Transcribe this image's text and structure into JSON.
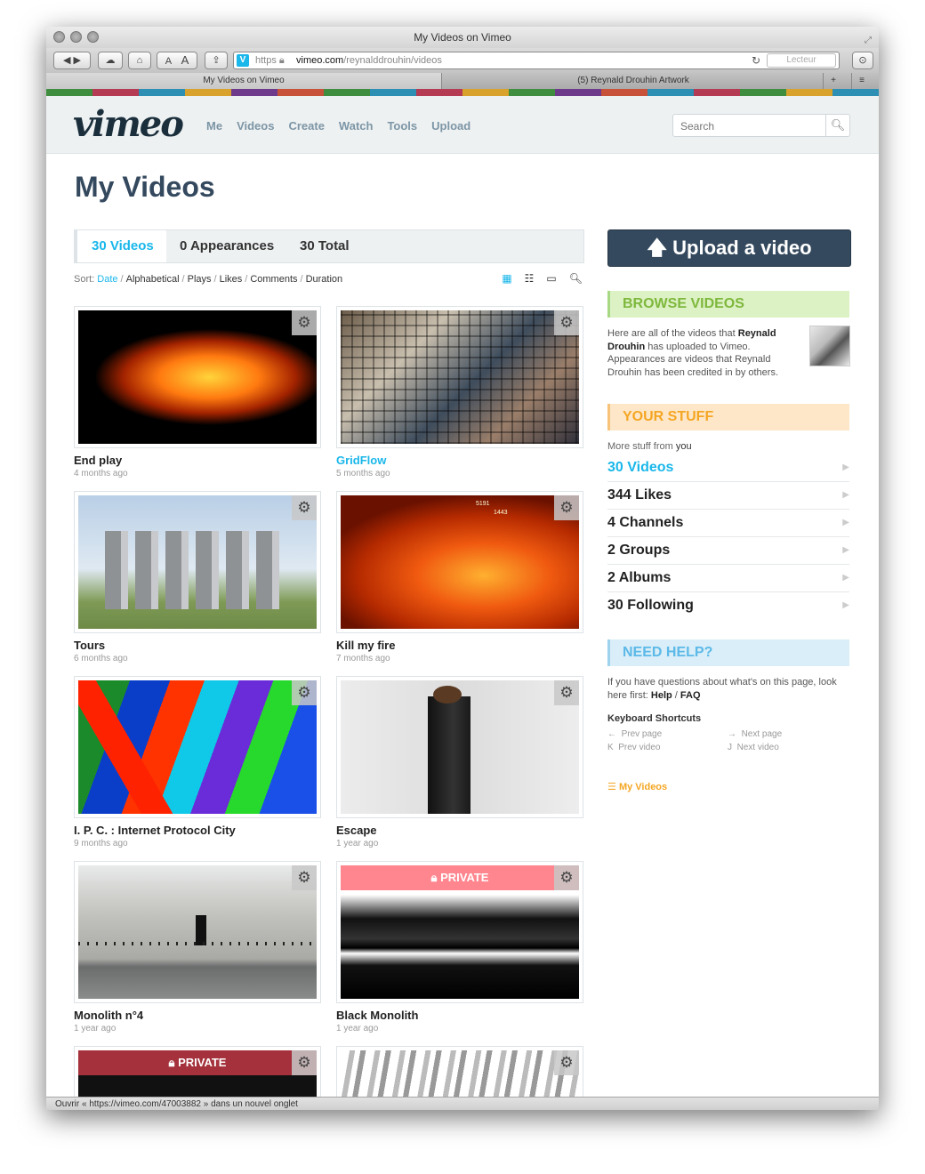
{
  "window": {
    "title": "My Videos on Vimeo",
    "url_scheme": "https",
    "url_host": "vimeo.com",
    "url_path": "/reynalddrouhin/videos",
    "reader_label": "Lecteur",
    "tabs": [
      "My Videos on Vimeo",
      "(5) Reynald Drouhin Artwork"
    ],
    "toolbar_text_small": "A",
    "toolbar_text_large": "A"
  },
  "header": {
    "logo": "vimeo",
    "nav": [
      "Me",
      "Videos",
      "Create",
      "Watch",
      "Tools",
      "Upload"
    ],
    "search_placeholder": "Search"
  },
  "page_title": "My Videos",
  "tabs": {
    "videos": "30 Videos",
    "appearances": "0 Appearances",
    "total": "30 Total"
  },
  "sort": {
    "label": "Sort:",
    "options": [
      "Date",
      "Alphabetical",
      "Plays",
      "Likes",
      "Comments",
      "Duration"
    ]
  },
  "videos": [
    {
      "title": "End play",
      "date": "4 months ago"
    },
    {
      "title": "GridFlow",
      "date": "5 months ago"
    },
    {
      "title": "Tours",
      "date": "6 months ago"
    },
    {
      "title": "Kill my fire",
      "date": "7 months ago"
    },
    {
      "title": "I. P. C. : Internet Protocol City",
      "date": "9 months ago"
    },
    {
      "title": "Escape",
      "date": "1 year ago"
    },
    {
      "title": "Monolith n°4",
      "date": "1 year ago"
    },
    {
      "title": "Black Monolith",
      "date": "1 year ago"
    }
  ],
  "private_label": "PRIVATE",
  "thumb_overlay": {
    "a": "5191",
    "b": "1443"
  },
  "sidebar": {
    "upload": "Upload a video",
    "browse_head": "BROWSE VIDEOS",
    "browse_text": {
      "p1": "Here are all of the videos that ",
      "name1": "Reynald Drouhin",
      "p2": " has uploaded to Vimeo. Appearances are videos that Reynald Drouhin has been credited in by others."
    },
    "stuff_head": "YOUR STUFF",
    "stuff_note_pre": "More stuff from ",
    "stuff_note_you": "you",
    "stuff": [
      "30 Videos",
      "344 Likes",
      "4 Channels",
      "2 Groups",
      "2 Albums",
      "30 Following"
    ],
    "help_head": "NEED HELP?",
    "help_text": {
      "p1": "If you have questions about what's on this page, look here first: ",
      "help": "Help",
      "sep": " / ",
      "faq": "FAQ"
    },
    "shortcuts_title": "Keyboard Shortcuts",
    "shortcuts": {
      "prev_page": "Prev page",
      "next_page": "Next page",
      "prev_video": "Prev video",
      "next_video": "Next video",
      "prev_page_key": "←",
      "next_page_key": "→",
      "prev_video_key": "K",
      "next_video_key": "J"
    },
    "rss_label": "My Videos"
  },
  "status_bar": "Ouvrir « https://vimeo.com/47003882 » dans un nouvel onglet",
  "colors": {
    "accent": "#1ab7ea",
    "navy": "#34495e"
  }
}
